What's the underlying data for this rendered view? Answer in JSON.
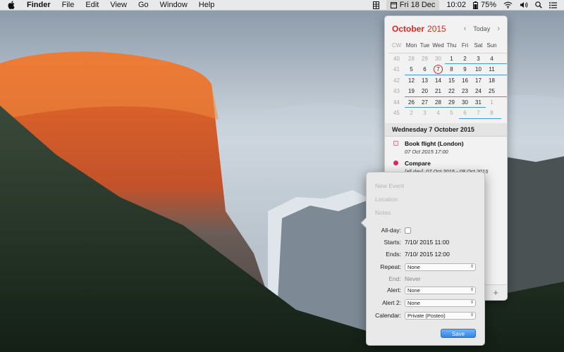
{
  "menubar": {
    "app_name": "Finder",
    "items": [
      "File",
      "Edit",
      "View",
      "Go",
      "Window",
      "Help"
    ],
    "clock": "Fri 18 Dec",
    "time": "10:02",
    "battery": "75%"
  },
  "calendar": {
    "month": "October",
    "year": "2015",
    "today_label": "Today",
    "week_header": "CW",
    "weekdays": [
      "Mon",
      "Tue",
      "Wed",
      "Thu",
      "Fri",
      "Sat",
      "Sun"
    ],
    "weeks": [
      {
        "cw": "40",
        "days": [
          "28",
          "29",
          "30",
          "1",
          "2",
          "3",
          "4"
        ]
      },
      {
        "cw": "41",
        "days": [
          "5",
          "6",
          "7",
          "8",
          "9",
          "10",
          "11"
        ]
      },
      {
        "cw": "42",
        "days": [
          "12",
          "13",
          "14",
          "15",
          "16",
          "17",
          "18"
        ]
      },
      {
        "cw": "43",
        "days": [
          "19",
          "20",
          "21",
          "22",
          "23",
          "24",
          "25"
        ]
      },
      {
        "cw": "44",
        "days": [
          "26",
          "27",
          "28",
          "29",
          "30",
          "31",
          "1"
        ]
      },
      {
        "cw": "45",
        "days": [
          "2",
          "3",
          "4",
          "5",
          "6",
          "7",
          "8"
        ]
      }
    ],
    "selected_day_header": "Wednesday 7 October 2015",
    "events": [
      {
        "title": "Book flight (London)",
        "detail": "07 Oct 2015 17:00",
        "color": "#e07a9a"
      },
      {
        "title": "Compare",
        "detail": "[all day], 07 Oct 2015 - 08 Oct 2015",
        "color": "#e0266a"
      }
    ],
    "add_label": "+"
  },
  "new_event": {
    "title_placeholder": "New Event",
    "location_placeholder": "Location",
    "notes_placeholder": "Notes",
    "allday_label": "All-day:",
    "starts_label": "Starts:",
    "starts_value": "7/10/ 2015  11:00",
    "ends_label": "Ends:",
    "ends_value": "7/10/ 2015  12:00",
    "repeat_label": "Repeat:",
    "repeat_value": "None",
    "end_label": "End:",
    "end_value": "Never",
    "alert_label": "Alert:",
    "alert_value": "None",
    "alert2_label": "Alert 2:",
    "alert2_value": "None",
    "calendar_label": "Calendar:",
    "calendar_value": "Private (Posteo)",
    "save_label": "Save"
  },
  "colors": {
    "accent_red": "#e0261f",
    "save_blue": "#2f86e6",
    "underline_blue": "#3a9bd9"
  }
}
